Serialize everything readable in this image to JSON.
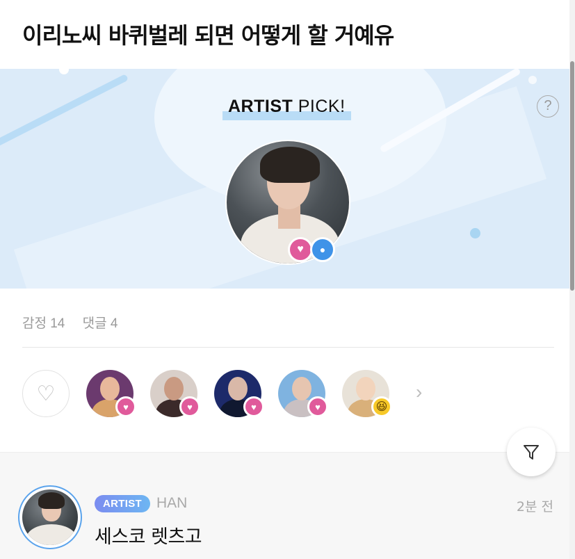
{
  "post": {
    "title": "이리노씨 바퀴벌레 되면 어떻게 할 거예유"
  },
  "banner": {
    "label_strong": "ARTIST",
    "label_rest": " PICK!",
    "help_icon": "question-circle-icon",
    "badges": {
      "heart": "♥",
      "chat": "●"
    }
  },
  "stats": {
    "reactions": "감정 14",
    "comments": "댓글 4"
  },
  "reactions": {
    "like_icon": "♡",
    "reactors": [
      {
        "name": "reactor-1",
        "badge": "♥",
        "badge_type": "heart",
        "colors": {
          "bg": "#6b3a6e",
          "head": "#e8b89b",
          "body": "#d9a36a"
        }
      },
      {
        "name": "reactor-2",
        "badge": "♥",
        "badge_type": "heart",
        "colors": {
          "bg": "#d9cfc9",
          "head": "#c99a82",
          "body": "#3b2a2a"
        }
      },
      {
        "name": "reactor-3",
        "badge": "♥",
        "badge_type": "heart",
        "colors": {
          "bg": "#1d2a6a",
          "head": "#d9b8a8",
          "body": "#101830"
        }
      },
      {
        "name": "reactor-4",
        "badge": "♥",
        "badge_type": "heart",
        "colors": {
          "bg": "#7fb3e0",
          "head": "#e6c5b0",
          "body": "#c9c0c2"
        }
      },
      {
        "name": "reactor-5",
        "badge": "😆",
        "badge_type": "laugh",
        "colors": {
          "bg": "#e8e2d8",
          "head": "#f2d4bc",
          "body": "#d9b07a"
        }
      }
    ],
    "more_icon": "›"
  },
  "comment": {
    "tag": "ARTIST",
    "author": "HAN",
    "time": "2분 전",
    "text": "세스코 렛츠고"
  },
  "colors": {
    "accent_blue": "#3f93e8",
    "heart_pink": "#e05a9b",
    "banner_bg": "#dcebf9"
  }
}
